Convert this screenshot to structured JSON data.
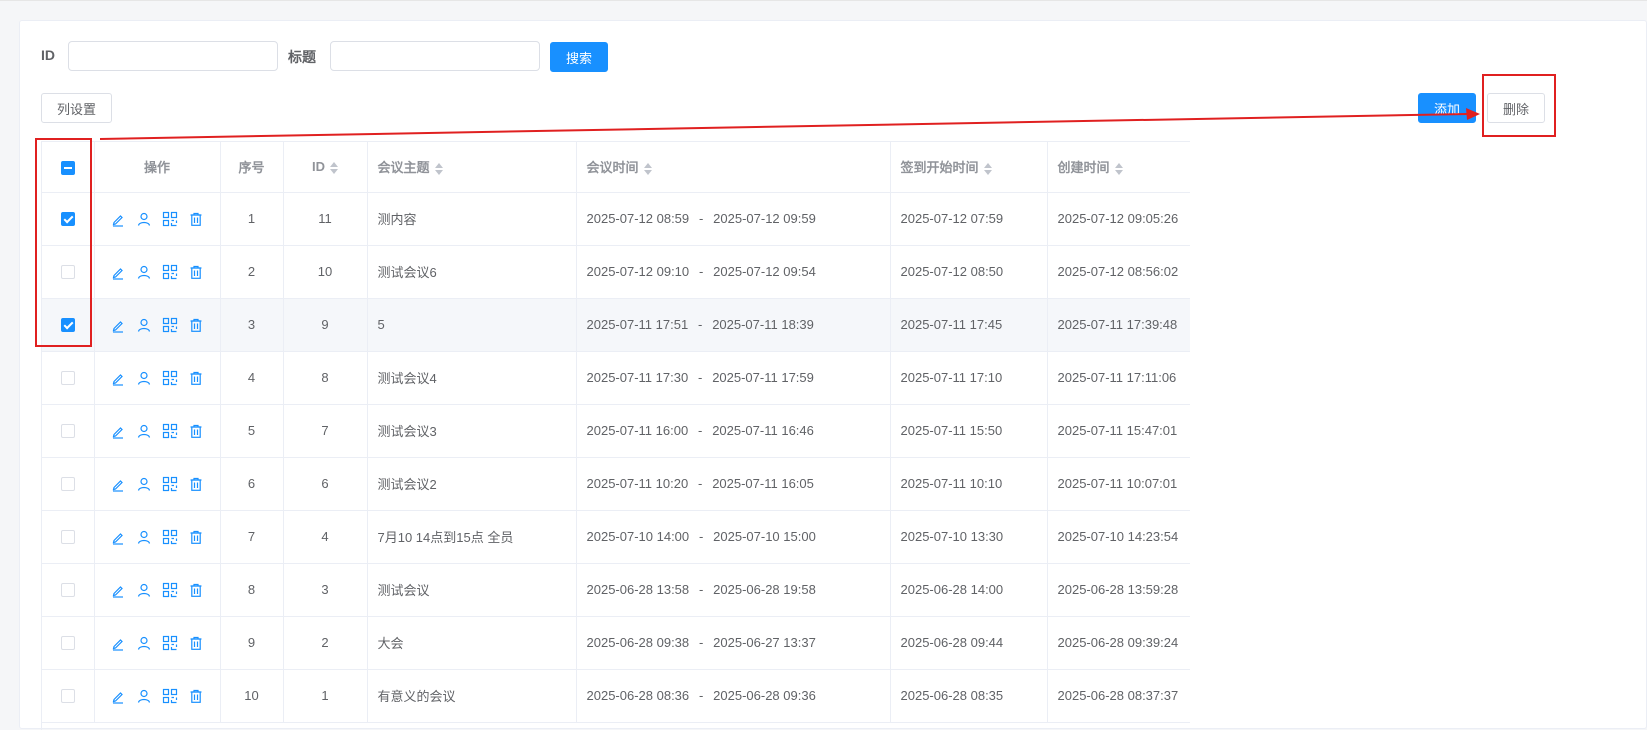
{
  "search": {
    "id_label": "ID",
    "id_value": "",
    "title_label": "标题",
    "title_value": "",
    "search_button": "搜索"
  },
  "toolbar": {
    "column_settings": "列设置",
    "add_button": "添加",
    "delete_button": "删除"
  },
  "table": {
    "headers": {
      "actions": "操作",
      "index": "序号",
      "id": "ID",
      "topic": "会议主题",
      "meeting_time": "会议时间",
      "checkin_start": "签到开始时间",
      "created": "创建时间"
    },
    "time_separator": "-",
    "select_all_state": "indeterminate",
    "rows": [
      {
        "index": "1",
        "id": "11",
        "topic": "测内容",
        "start": "2025-07-12 08:59",
        "end": "2025-07-12 09:59",
        "checkin": "2025-07-12 07:59",
        "created": "2025-07-12 09:05:26",
        "checked": true
      },
      {
        "index": "2",
        "id": "10",
        "topic": "测试会议6",
        "start": "2025-07-12 09:10",
        "end": "2025-07-12 09:54",
        "checkin": "2025-07-12 08:50",
        "created": "2025-07-12 08:56:02",
        "checked": false
      },
      {
        "index": "3",
        "id": "9",
        "topic": "5",
        "start": "2025-07-11 17:51",
        "end": "2025-07-11 18:39",
        "checkin": "2025-07-11 17:45",
        "created": "2025-07-11 17:39:48",
        "checked": true
      },
      {
        "index": "4",
        "id": "8",
        "topic": "测试会议4",
        "start": "2025-07-11 17:30",
        "end": "2025-07-11 17:59",
        "checkin": "2025-07-11 17:10",
        "created": "2025-07-11 17:11:06",
        "checked": false
      },
      {
        "index": "5",
        "id": "7",
        "topic": "测试会议3",
        "start": "2025-07-11 16:00",
        "end": "2025-07-11 16:46",
        "checkin": "2025-07-11 15:50",
        "created": "2025-07-11 15:47:01",
        "checked": false
      },
      {
        "index": "6",
        "id": "6",
        "topic": "测试会议2",
        "start": "2025-07-11 10:20",
        "end": "2025-07-11 16:05",
        "checkin": "2025-07-11 10:10",
        "created": "2025-07-11 10:07:01",
        "checked": false
      },
      {
        "index": "7",
        "id": "4",
        "topic": "7月10 14点到15点 全员",
        "start": "2025-07-10 14:00",
        "end": "2025-07-10 15:00",
        "checkin": "2025-07-10 13:30",
        "created": "2025-07-10 14:23:54",
        "checked": false
      },
      {
        "index": "8",
        "id": "3",
        "topic": "测试会议",
        "start": "2025-06-28 13:58",
        "end": "2025-06-28 19:58",
        "checkin": "2025-06-28 14:00",
        "created": "2025-06-28 13:59:28",
        "checked": false
      },
      {
        "index": "9",
        "id": "2",
        "topic": "大会",
        "start": "2025-06-28 09:38",
        "end": "2025-06-27 13:37",
        "checkin": "2025-06-28 09:44",
        "created": "2025-06-28 09:39:24",
        "checked": false
      },
      {
        "index": "10",
        "id": "1",
        "topic": "有意义的会议",
        "start": "2025-06-28 08:36",
        "end": "2025-06-28 09:36",
        "checkin": "2025-06-28 08:35",
        "created": "2025-06-28 08:37:37",
        "checked": false
      }
    ]
  },
  "icons": {
    "row_actions": [
      "edit-icon",
      "user-icon",
      "qrcode-icon",
      "delete-icon"
    ]
  },
  "colors": {
    "primary": "#1890ff",
    "annotation": "#e02020",
    "highlight_row": "#f5f7fa"
  }
}
